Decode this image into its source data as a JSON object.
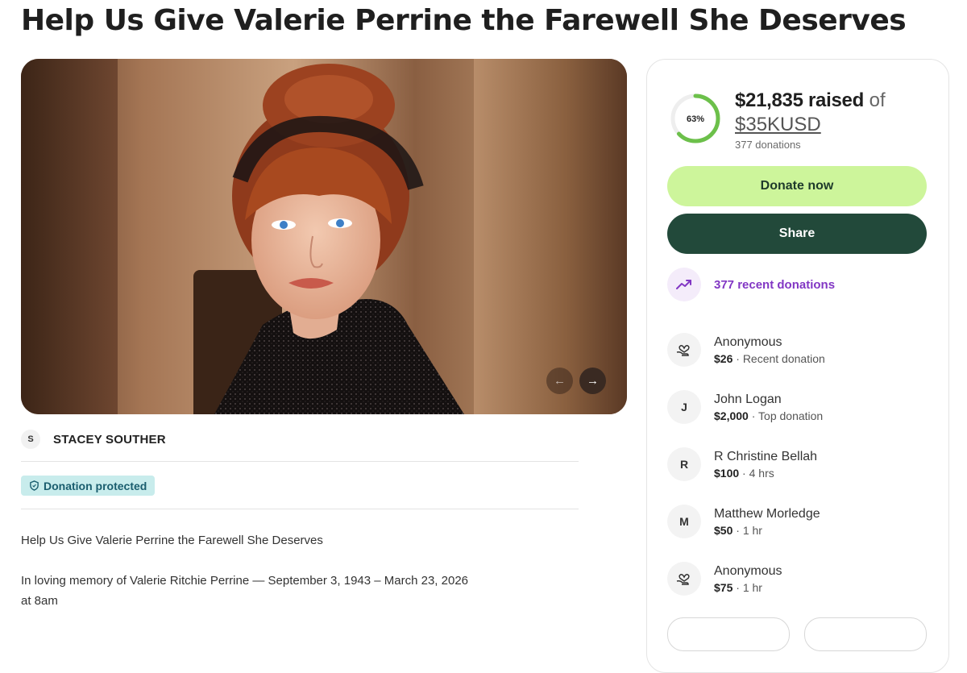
{
  "page": {
    "title": "Help Us Give Valerie Perrine the Farewell She Deserves"
  },
  "carousel": {
    "total_slides": 5,
    "active_slide": 1,
    "prev_icon": "arrow-left-icon",
    "next_icon": "arrow-right-icon"
  },
  "organizer": {
    "initial": "S",
    "name": "STACEY SOUTHER"
  },
  "badge": {
    "label": "Donation protected",
    "icon": "shield-icon"
  },
  "story": {
    "line1": "Help Us Give Valerie Perrine the Farewell She Deserves",
    "line2a": "In loving memory of Valerie Ritchie Perrine — September 3, 1943 – March 23, 2026",
    "line2b": "at 8am"
  },
  "progress": {
    "percent": 63,
    "percent_label": "63%",
    "raised_amount": "$21,835 raised",
    "of_text": "of",
    "goal": "$35KUSD",
    "donation_count": "377 donations"
  },
  "actions": {
    "donate_label": "Donate now",
    "share_label": "Share"
  },
  "recent": {
    "label": "377 recent donations",
    "icon": "trending-up-icon"
  },
  "donations": [
    {
      "name": "Anonymous",
      "avatar": "heart-hand-icon",
      "initial": "",
      "amount": "$26",
      "note": "Recent donation"
    },
    {
      "name": "John Logan",
      "avatar": "",
      "initial": "J",
      "amount": "$2,000",
      "note": "Top donation"
    },
    {
      "name": "R Christine Bellah",
      "avatar": "",
      "initial": "R",
      "amount": "$100",
      "note": "4 hrs"
    },
    {
      "name": "Matthew Morledge",
      "avatar": "",
      "initial": "M",
      "amount": "$50",
      "note": "1 hr"
    },
    {
      "name": "Anonymous",
      "avatar": "heart-hand-icon",
      "initial": "",
      "amount": "$75",
      "note": "1 hr"
    }
  ],
  "colors": {
    "donate_bg": "#cdf59b",
    "share_bg": "#22493a",
    "progress_ring": "#6cc04a",
    "recent_accent": "#8237c4",
    "badge_bg": "#c8ecec"
  }
}
